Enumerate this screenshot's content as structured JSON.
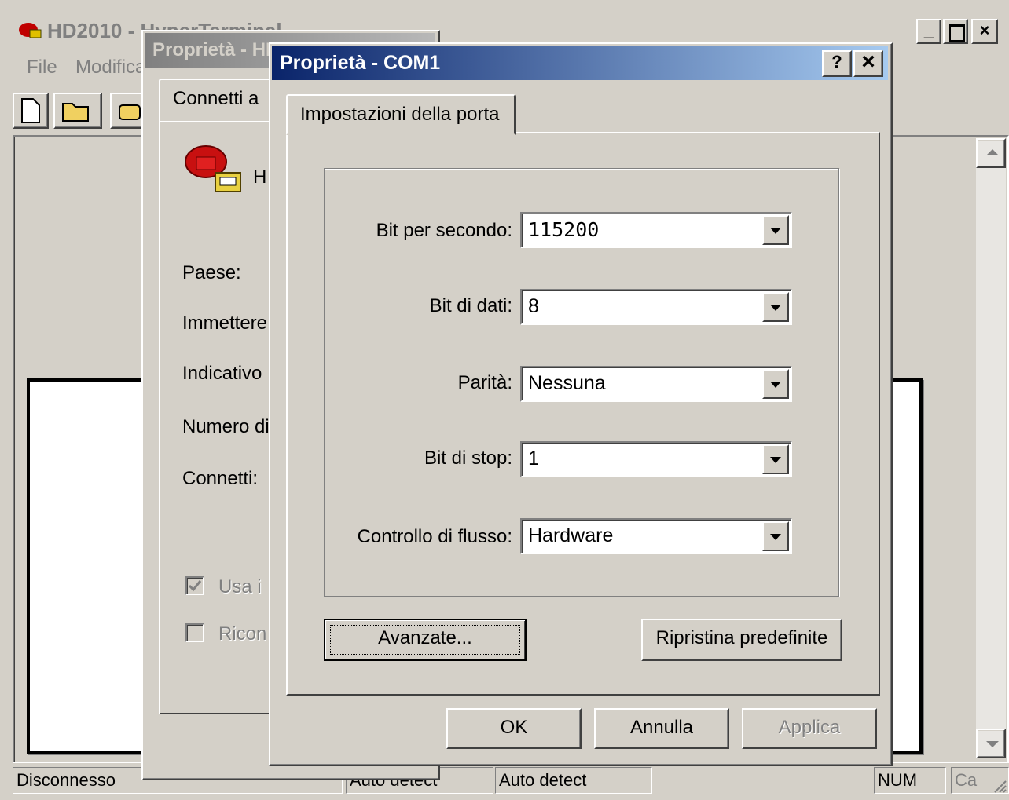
{
  "main_window": {
    "title": "HD2010 - HyperTerminal",
    "menu": [
      "File",
      "Modifica"
    ],
    "status": {
      "connection": "Disconnesso",
      "detect1": "Auto detect",
      "detect2": "Auto detect",
      "num": "NUM",
      "caps": "Ca"
    }
  },
  "back_dialog": {
    "title": "Proprietà - HD2010",
    "tab": "Connetti a",
    "icon_label": "H",
    "fields": [
      "Paese:",
      "Immettere",
      "Indicativo",
      "Numero di",
      "Connetti:"
    ],
    "check1": "Usa i",
    "check2": "Ricon"
  },
  "dialog": {
    "title": "Proprietà - COM1",
    "help_btn": "?",
    "close_btn": "×",
    "tab": "Impostazioni della porta",
    "rows": [
      {
        "label": "Bit per secondo:",
        "value": "115200"
      },
      {
        "label": "Bit di dati:",
        "value": "8"
      },
      {
        "label": "Parità:",
        "value": "Nessuna"
      },
      {
        "label": "Bit di stop:",
        "value": "1"
      },
      {
        "label": "Controllo di flusso:",
        "value": "Hardware"
      }
    ],
    "advanced_btn": "Avanzate...",
    "restore_btn": "Ripristina predefinite",
    "ok_btn": "OK",
    "cancel_btn": "Annulla",
    "apply_btn": "Applica"
  }
}
